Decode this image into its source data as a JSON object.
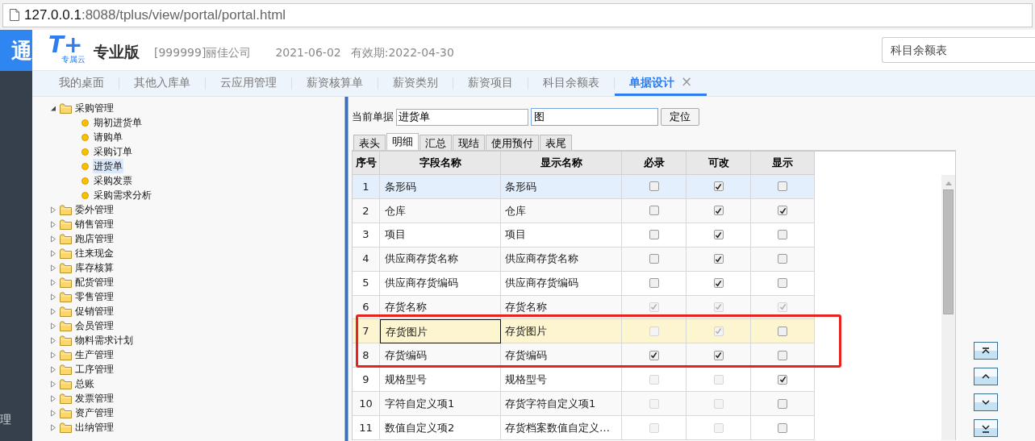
{
  "browser": {
    "url_host": "127.0.0.1",
    "url_rest": ":8088/tplus/view/portal/portal.html"
  },
  "side_strip": {
    "top_glyph": "通",
    "bottom_glyph": "理"
  },
  "header": {
    "logo_mark": "T+",
    "logo_sub": "专属云",
    "edition": "专业版",
    "company": "[999999]丽佳公司",
    "date": "2021-06-02",
    "validity": "有效期:2022-04-30",
    "search_value": "科目余额表"
  },
  "tabs": [
    {
      "label": "我的桌面",
      "selected": false,
      "closable": false
    },
    {
      "label": "其他入库单",
      "selected": false,
      "closable": false
    },
    {
      "label": "云应用管理",
      "selected": false,
      "closable": false
    },
    {
      "label": "薪资核算单",
      "selected": false,
      "closable": false
    },
    {
      "label": "薪资类别",
      "selected": false,
      "closable": false
    },
    {
      "label": "薪资项目",
      "selected": false,
      "closable": false
    },
    {
      "label": "科目余额表",
      "selected": false,
      "closable": false
    },
    {
      "label": "单据设计",
      "selected": true,
      "closable": true,
      "close_glyph": "×"
    }
  ],
  "tree": [
    {
      "label": "采购管理",
      "expanded": true,
      "children": [
        {
          "label": "期初进货单",
          "selected": false
        },
        {
          "label": "请购单",
          "selected": false
        },
        {
          "label": "采购订单",
          "selected": false
        },
        {
          "label": "进货单",
          "selected": true
        },
        {
          "label": "采购发票",
          "selected": false
        },
        {
          "label": "采购需求分析",
          "selected": false
        }
      ]
    },
    {
      "label": "委外管理",
      "expanded": false
    },
    {
      "label": "销售管理",
      "expanded": false
    },
    {
      "label": "跑店管理",
      "expanded": false
    },
    {
      "label": "往来现金",
      "expanded": false
    },
    {
      "label": "库存核算",
      "expanded": false
    },
    {
      "label": "配货管理",
      "expanded": false
    },
    {
      "label": "零售管理",
      "expanded": false
    },
    {
      "label": "促销管理",
      "expanded": false
    },
    {
      "label": "会员管理",
      "expanded": false
    },
    {
      "label": "物料需求计划",
      "expanded": false
    },
    {
      "label": "生产管理",
      "expanded": false
    },
    {
      "label": "工序管理",
      "expanded": false
    },
    {
      "label": "总账",
      "expanded": false
    },
    {
      "label": "发票管理",
      "expanded": false
    },
    {
      "label": "资产管理",
      "expanded": false
    },
    {
      "label": "出纳管理",
      "expanded": false
    }
  ],
  "form": {
    "doc_label": "当前单据",
    "doc_value": "进货单",
    "find_value": "图",
    "locate_button": "定位"
  },
  "sub_tabs": [
    {
      "label": "表头",
      "selected": false
    },
    {
      "label": "明细",
      "selected": true
    },
    {
      "label": "汇总",
      "selected": false
    },
    {
      "label": "现结",
      "selected": false
    },
    {
      "label": "使用预付",
      "selected": false
    },
    {
      "label": "表尾",
      "selected": false
    }
  ],
  "table": {
    "columns": [
      "序号",
      "字段名称",
      "显示名称",
      "必录",
      "可改",
      "显示"
    ],
    "rows": [
      {
        "no": "1",
        "field": "条形码",
        "display": "条形码",
        "selected": true,
        "editing": false,
        "checks": [
          {
            "checked": false,
            "disabled": false
          },
          {
            "checked": true,
            "disabled": false
          },
          {
            "checked": false,
            "disabled": false
          }
        ]
      },
      {
        "no": "2",
        "field": "仓库",
        "display": "仓库",
        "selected": false,
        "editing": false,
        "checks": [
          {
            "checked": false,
            "disabled": false
          },
          {
            "checked": true,
            "disabled": false
          },
          {
            "checked": true,
            "disabled": false
          }
        ]
      },
      {
        "no": "3",
        "field": "项目",
        "display": "项目",
        "selected": false,
        "editing": false,
        "checks": [
          {
            "checked": false,
            "disabled": false
          },
          {
            "checked": true,
            "disabled": false
          },
          {
            "checked": false,
            "disabled": false
          }
        ]
      },
      {
        "no": "4",
        "field": "供应商存货名称",
        "display": "供应商存货名称",
        "selected": false,
        "editing": false,
        "checks": [
          {
            "checked": false,
            "disabled": false
          },
          {
            "checked": true,
            "disabled": false
          },
          {
            "checked": false,
            "disabled": false
          }
        ]
      },
      {
        "no": "5",
        "field": "供应商存货编码",
        "display": "供应商存货编码",
        "selected": false,
        "editing": false,
        "checks": [
          {
            "checked": false,
            "disabled": false
          },
          {
            "checked": true,
            "disabled": false
          },
          {
            "checked": false,
            "disabled": false
          }
        ]
      },
      {
        "no": "6",
        "field": "存货名称",
        "display": "存货名称",
        "selected": false,
        "editing": false,
        "checks": [
          {
            "checked": true,
            "disabled": true
          },
          {
            "checked": true,
            "disabled": true
          },
          {
            "checked": true,
            "disabled": true
          }
        ]
      },
      {
        "no": "7",
        "field": "存货图片",
        "display": "存货图片",
        "selected": false,
        "editing": true,
        "checks": [
          {
            "checked": false,
            "disabled": true
          },
          {
            "checked": true,
            "disabled": true
          },
          {
            "checked": false,
            "disabled": false
          }
        ]
      },
      {
        "no": "8",
        "field": "存货编码",
        "display": "存货编码",
        "selected": false,
        "editing": false,
        "checks": [
          {
            "checked": true,
            "disabled": false
          },
          {
            "checked": true,
            "disabled": false
          },
          {
            "checked": false,
            "disabled": false
          }
        ]
      },
      {
        "no": "9",
        "field": "规格型号",
        "display": "规格型号",
        "selected": false,
        "editing": false,
        "checks": [
          {
            "checked": false,
            "disabled": true
          },
          {
            "checked": false,
            "disabled": true
          },
          {
            "checked": true,
            "disabled": false
          }
        ]
      },
      {
        "no": "10",
        "field": "字符自定义项1",
        "display": "存货字符自定义项1",
        "selected": false,
        "editing": false,
        "checks": [
          {
            "checked": false,
            "disabled": true
          },
          {
            "checked": false,
            "disabled": true
          },
          {
            "checked": false,
            "disabled": false
          }
        ]
      },
      {
        "no": "11",
        "field": "数值自定义项2",
        "display": "存货档案数值自定义…",
        "selected": false,
        "editing": false,
        "checks": [
          {
            "checked": false,
            "disabled": true
          },
          {
            "checked": false,
            "disabled": true
          },
          {
            "checked": false,
            "disabled": false
          }
        ]
      }
    ]
  },
  "annotation": {
    "visible": true,
    "color": "#e8221c"
  }
}
